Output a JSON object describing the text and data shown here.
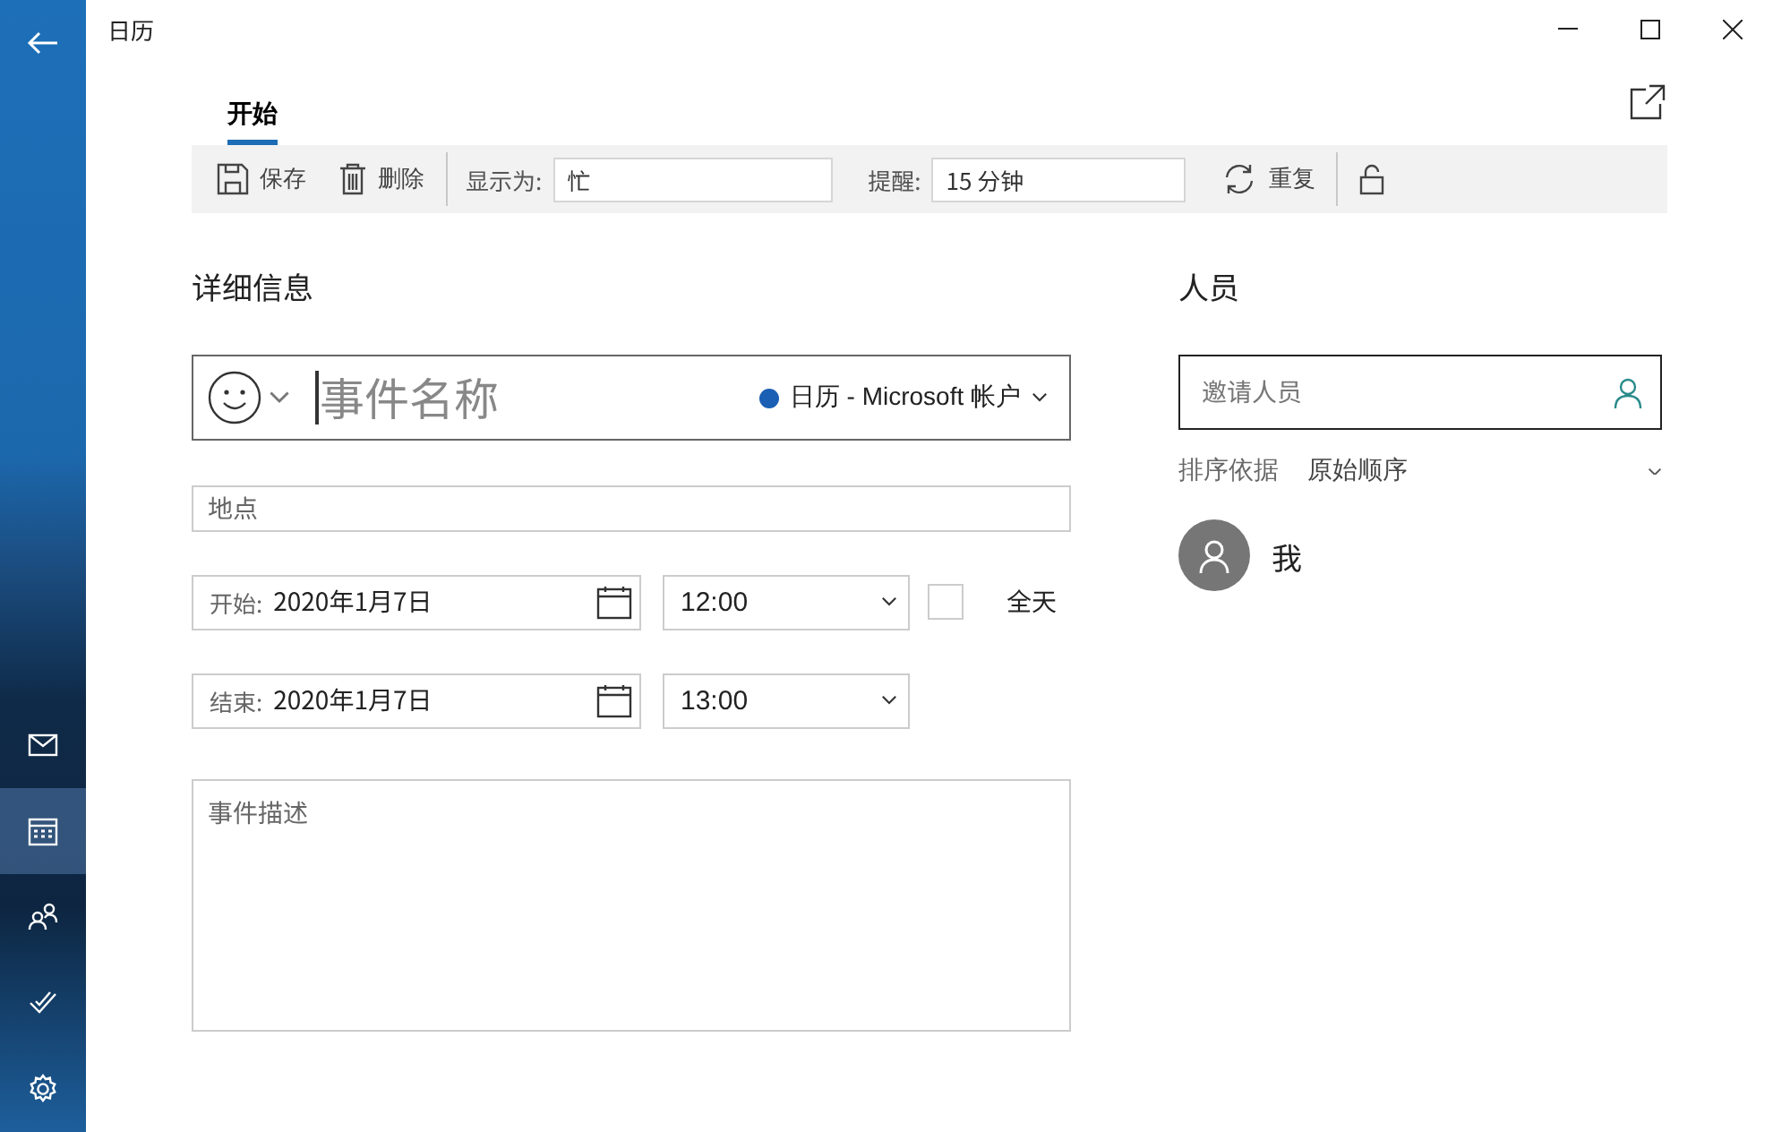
{
  "window": {
    "title": "日历"
  },
  "sidebar": {
    "items": [
      {
        "kind": "mail",
        "selected": false
      },
      {
        "kind": "calendar",
        "selected": true
      },
      {
        "kind": "people",
        "selected": false
      },
      {
        "kind": "todo",
        "selected": false
      },
      {
        "kind": "settings",
        "selected": false
      }
    ]
  },
  "tabs": [
    {
      "label": "开始",
      "selected": true
    }
  ],
  "toolbar": {
    "save": "保存",
    "delete": "删除",
    "show_as_label": "显示为:",
    "show_as": "忙",
    "reminder_label": "提醒:",
    "reminder": "15 分钟",
    "repeat": "重复"
  },
  "details": {
    "heading": "详细信息",
    "event_name": {
      "placeholder": "事件名称"
    },
    "calendar": "日历 - Microsoft 帐户",
    "location": {
      "placeholder": "地点"
    },
    "times": [
      {
        "label": "开始:",
        "date": "2020年1月7日",
        "time": "12:00"
      },
      {
        "label": "结束:",
        "date": "2020年1月7日",
        "time": "13:00"
      }
    ],
    "all_day": {
      "label": "全天",
      "checked": false
    },
    "description": {
      "placeholder": "事件描述"
    }
  },
  "people": {
    "heading": "人员",
    "invite": {
      "placeholder": "邀请人员"
    },
    "sort_label": "排序依据",
    "sort_value": "原始顺序",
    "attendees": [
      {
        "name": "我"
      }
    ]
  }
}
